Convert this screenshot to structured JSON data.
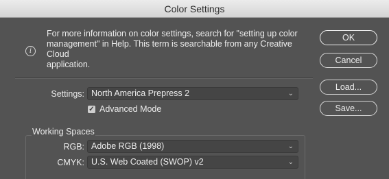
{
  "window": {
    "title": "Color Settings"
  },
  "info": {
    "icon": "info-icon",
    "line1": "For more information on color settings, search for \"setting up color",
    "line2": "management\" in Help. This term is searchable from any Creative Cloud",
    "line3": "application."
  },
  "buttons": {
    "ok": "OK",
    "cancel": "Cancel",
    "load": "Load...",
    "save": "Save..."
  },
  "settings": {
    "label": "Settings:",
    "value": "North America Prepress 2",
    "advanced_mode_label": "Advanced Mode",
    "advanced_mode_checked": true
  },
  "working_spaces": {
    "title": "Working Spaces",
    "rgb_label": "RGB:",
    "rgb_value": "Adobe RGB (1998)",
    "cmyk_label": "CMYK:",
    "cmyk_value": "U.S. Web Coated (SWOP) v2"
  },
  "colors": {
    "dialog_bg": "#535353",
    "titlebar_bg": "#e0e0e0",
    "text": "#ececec"
  }
}
